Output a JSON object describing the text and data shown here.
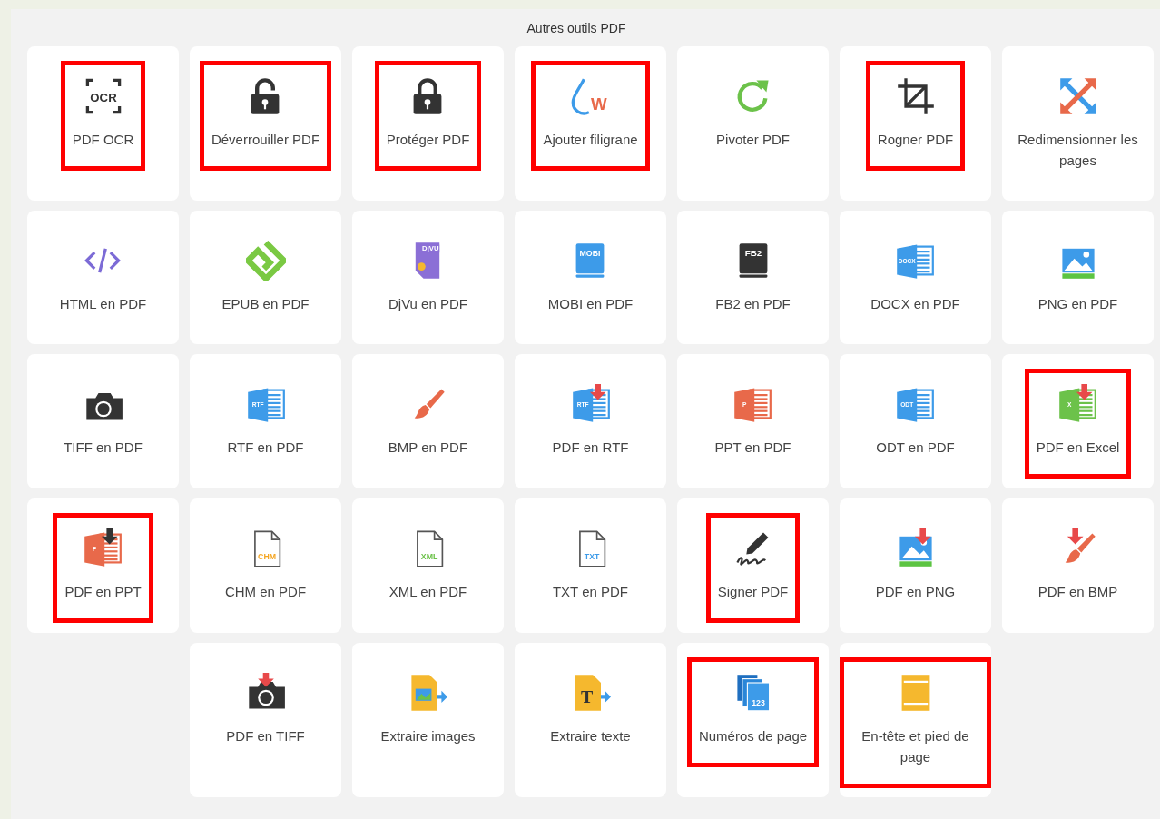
{
  "title": "Autres outils PDF",
  "rows": [
    {
      "tools": [
        {
          "label": "PDF OCR",
          "icon_text": "OCR",
          "highlighted": true
        },
        {
          "label": "Déverrouiller PDF",
          "highlighted": true
        },
        {
          "label": "Protéger PDF",
          "highlighted": true
        },
        {
          "label": "Ajouter filigrane",
          "icon_text": "W",
          "highlighted": true
        },
        {
          "label": "Pivoter PDF",
          "highlighted": false
        },
        {
          "label": "Rogner PDF",
          "highlighted": true
        },
        {
          "label": "Redimensionner les pages",
          "highlighted": false
        }
      ]
    },
    {
      "tools": [
        {
          "label": "HTML en PDF",
          "highlighted": false
        },
        {
          "label": "EPUB en PDF",
          "highlighted": false
        },
        {
          "label": "DjVu en PDF",
          "icon_text": "DjVU",
          "highlighted": false
        },
        {
          "label": "MOBI en PDF",
          "icon_text": "MOBI",
          "highlighted": false
        },
        {
          "label": "FB2 en PDF",
          "icon_text": "FB2",
          "highlighted": false
        },
        {
          "label": "DOCX en PDF",
          "icon_text": "DOCX",
          "highlighted": false
        },
        {
          "label": "PNG en PDF",
          "highlighted": false
        }
      ]
    },
    {
      "tools": [
        {
          "label": "TIFF en PDF",
          "highlighted": false
        },
        {
          "label": "RTF en PDF",
          "icon_text": "RTF",
          "highlighted": false
        },
        {
          "label": "BMP en PDF",
          "highlighted": false
        },
        {
          "label": "PDF en RTF",
          "icon_text": "RTF",
          "highlighted": false
        },
        {
          "label": "PPT en PDF",
          "icon_text": "P",
          "highlighted": false
        },
        {
          "label": "ODT en PDF",
          "icon_text": "ODT",
          "highlighted": false
        },
        {
          "label": "PDF en Excel",
          "icon_text": "X",
          "highlighted": true
        }
      ]
    },
    {
      "tools": [
        {
          "label": "PDF en PPT",
          "icon_text": "P",
          "highlighted": true
        },
        {
          "label": "CHM en PDF",
          "icon_text": "CHM",
          "highlighted": false
        },
        {
          "label": "XML en PDF",
          "icon_text": "XML",
          "highlighted": false
        },
        {
          "label": "TXT en PDF",
          "icon_text": "TXT",
          "highlighted": false
        },
        {
          "label": "Signer PDF",
          "highlighted": true
        },
        {
          "label": "PDF en PNG",
          "highlighted": false
        },
        {
          "label": "PDF en BMP",
          "highlighted": false
        }
      ]
    },
    {
      "tools": [
        {
          "label": "PDF en TIFF",
          "highlighted": false
        },
        {
          "label": "Extraire images",
          "highlighted": false
        },
        {
          "label": "Extraire texte",
          "icon_text": "T",
          "highlighted": false
        },
        {
          "label": "Numéros de page",
          "icon_text": "123",
          "highlighted": true
        },
        {
          "label": "En-tête et pied de page",
          "highlighted": true
        }
      ]
    }
  ]
}
